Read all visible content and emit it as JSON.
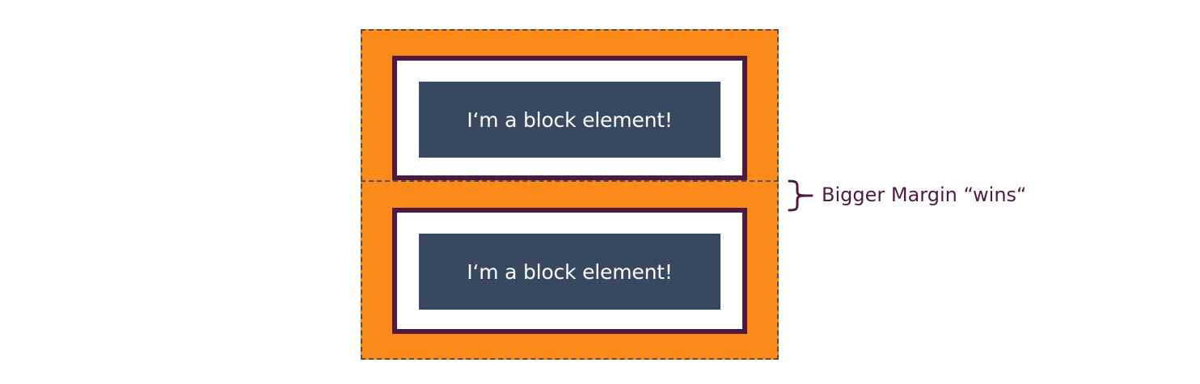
{
  "blocks": [
    {
      "label": "I‘m a block element!"
    },
    {
      "label": "I‘m a block element!"
    }
  ],
  "annotation": {
    "text": "Bigger Margin “wins“"
  },
  "colors": {
    "margin": "#fc8a1b",
    "border": "#4e1a43",
    "padding": "#ffffff",
    "content": "#384861",
    "content_text": "#ffffff",
    "annotation_text": "#4e1a43",
    "dashed_line": "#505050"
  }
}
